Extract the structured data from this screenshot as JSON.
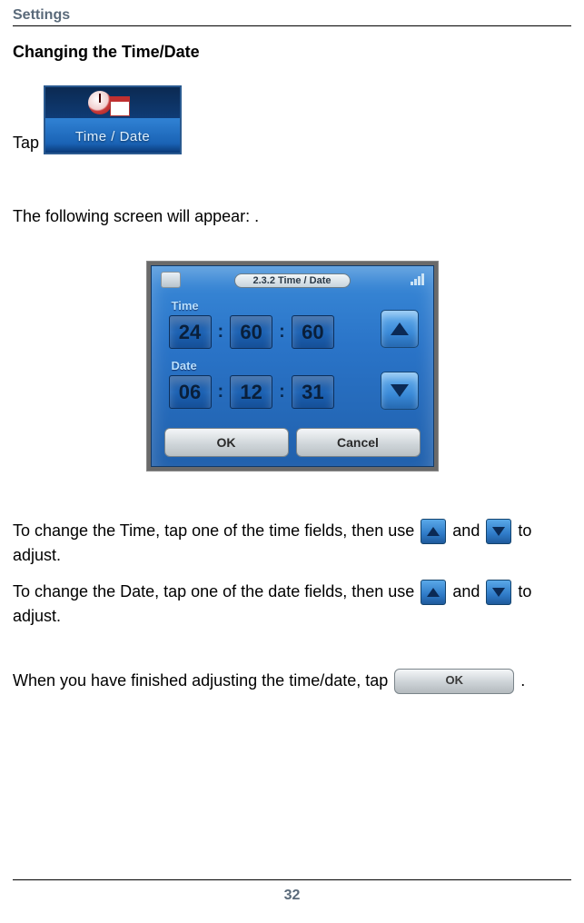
{
  "header": "Settings",
  "section_title": "Changing the Time/Date",
  "tap_label": "Tap",
  "timedate_button": {
    "label": "Time / Date"
  },
  "following_text": "The following screen will appear: .",
  "screen": {
    "title": "2.3.2 Time / Date",
    "time_label": "Time",
    "date_label": "Date",
    "time_values": [
      "24",
      "60",
      "60"
    ],
    "date_values": [
      "06",
      "12",
      "31"
    ],
    "ok_label": "OK",
    "cancel_label": "Cancel"
  },
  "para_time_a": "To change the Time, tap one of the time fields, then use ",
  "and_word": " and ",
  "to_adjust": " to adjust.",
  "para_date_a": "To change the Date, tap one of the date fields, then use ",
  "para_finish_a": "When you have finished adjusting the time/date, tap ",
  "period": ".",
  "page_number": "32"
}
